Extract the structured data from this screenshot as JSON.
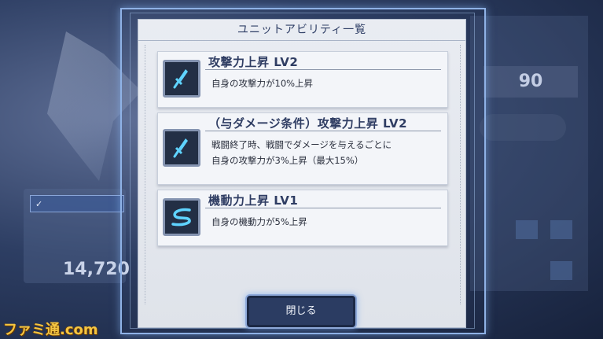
{
  "dialog": {
    "title": "ユニットアビリティ一覧",
    "close_label": "閉じる"
  },
  "abilities": [
    {
      "name": "攻撃力上昇 LV2",
      "icon": "sword-icon",
      "description": [
        "自身の攻撃力が10%上昇"
      ]
    },
    {
      "name": "（与ダメージ条件）攻撃力上昇 LV2",
      "icon": "sword-icon",
      "description": [
        "戦闘終了時、戦闘でダメージを与えるごとに",
        "自身の攻撃力が3%上昇（最大15%）"
      ]
    },
    {
      "name": "機動力上昇 LV1",
      "icon": "swoosh-icon",
      "description": [
        "自身の機動力が5%上昇"
      ]
    }
  ],
  "background": {
    "power_value": "14,720",
    "stat_value": "90"
  },
  "watermark": "ファミ通.com",
  "colors": {
    "accent": "#8fb2e6",
    "icon_glow": "#5fd3ff",
    "title_text": "#2f3d63"
  }
}
